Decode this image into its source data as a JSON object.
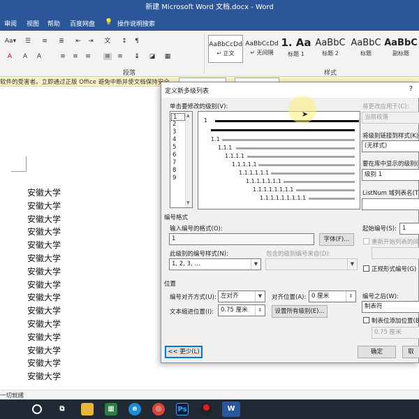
{
  "window": {
    "title": "新建 Microsoft Word 文档.docx  -  Word"
  },
  "menu": {
    "items": [
      "审阅",
      "视图",
      "帮助",
      "百度网盘"
    ],
    "search": "操作说明搜索"
  },
  "ribbon": {
    "paragraph_label": "段落",
    "styles_label": "样式",
    "styles": [
      {
        "sample": "AaBbCcDd",
        "name": "↵ 正文"
      },
      {
        "sample": "AaBbCcDd",
        "name": "↵ 无间隔"
      },
      {
        "sample": "1. Aa",
        "name": "标题 1"
      },
      {
        "sample": "AaBbC",
        "name": "标题 2"
      },
      {
        "sample": "AaBbC",
        "name": "标题"
      },
      {
        "sample": "AaBbC",
        "name": "副标题"
      }
    ]
  },
  "message_bar": {
    "text": "软件的受害者。立即通过正版 Office 避免中断并使文档保持安全。"
  },
  "document": {
    "lines": [
      "安徽大学",
      "安徽大学",
      "安徽大学",
      "安徽大学",
      "安徽大学",
      "安徽大学",
      "安徽大学",
      "安徽大学",
      "安徽大学",
      "安徽大学",
      "安徽大学",
      "安徽大学",
      "安徽大学",
      "安徽大学",
      "安徽大学",
      "安徽大学"
    ]
  },
  "status": {
    "text": "一切就绪"
  },
  "dialog": {
    "title": "定义新多级列表",
    "help": "?",
    "click_level_label": "单击要修改的级别(V):",
    "levels": [
      "1",
      "2",
      "3",
      "4",
      "5",
      "6",
      "7",
      "8",
      "9"
    ],
    "preview_numbers": [
      "1",
      "1.1",
      "1.1.1",
      "1.1.1.1",
      "1.1.1.1.1",
      "1.1.1.1.1.1",
      "1.1.1.1.1.1.1",
      "1.1.1.1.1.1.1.1",
      "1.1.1.1.1.1.1.1.1"
    ],
    "apply_to_label": "将更改应用于(C):",
    "apply_to_value": "当前段落",
    "link_style_label": "将级别链接到样式(K):",
    "link_style_value": "(无样式)",
    "gallery_level_label": "要在库中显示的级别(H):",
    "gallery_level_value": "级别 1",
    "listnum_label": "ListNum 域列表名(T):",
    "listnum_value": "",
    "number_format_section": "编号格式",
    "enter_format_label": "输入编号的格式(O):",
    "enter_format_value": "1",
    "font_button": "字体(F)...",
    "start_at_label": "起始编号(S):",
    "start_at_value": "1",
    "restart_label": "重新开始列表的间隔",
    "number_style_label": "此级别的编号样式(N):",
    "number_style_value": "1, 2, 3, ...",
    "include_level_label": "包含的级别编号来自(D):",
    "include_level_value": "",
    "legal_label": "正规形式编号(G)",
    "position_section": "位置",
    "alignment_label": "编号对齐方式(U):",
    "alignment_value": "左对齐",
    "aligned_at_label": "对齐位置(A):",
    "aligned_at_value": "0 厘米",
    "follow_label": "编号之后(W):",
    "follow_value": "制表符",
    "indent_label": "文本缩进位置(I):",
    "indent_value": "0.75 厘米",
    "set_all_button": "设置所有级别(E)...",
    "tab_stop_label": "制表位添加位置(B):",
    "tab_stop_value": "0.75 厘米",
    "less_button": "<< 更少(L)",
    "ok_button": "确定",
    "cancel_button": "取"
  }
}
